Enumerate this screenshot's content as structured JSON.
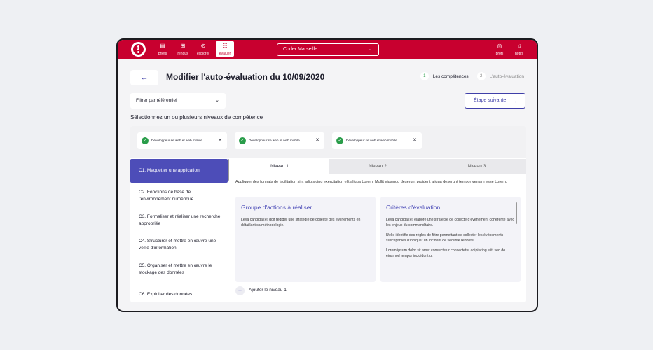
{
  "nav": {
    "items": [
      {
        "label": "briefs",
        "icon": "clipboard-icon"
      },
      {
        "label": "rendus",
        "icon": "gift-icon"
      },
      {
        "label": "explorer",
        "icon": "compass-icon"
      },
      {
        "label": "évaluer",
        "icon": "checklist-icon"
      }
    ],
    "select_value": "Coder Marseille",
    "right_items": [
      {
        "label": "profil",
        "icon": "user-icon"
      },
      {
        "label": "notifs",
        "icon": "bell-icon"
      }
    ]
  },
  "header": {
    "back_icon": "arrow-left-icon",
    "title": "Modifier l'auto-évaluation du 10/09/2020",
    "steps": [
      {
        "num": "1",
        "label": "Les compétences"
      },
      {
        "num": "2",
        "label": "L'auto-évaluation"
      }
    ]
  },
  "filter": {
    "value": "Filtrer par référentiel"
  },
  "next_button": {
    "label": "Étape suivante"
  },
  "subtitle": "Sélectionnez un ou plusieurs niveaux de compétence",
  "chips": [
    {
      "label": "Développeur.se web et web mobile"
    },
    {
      "label": "Développeur.se web et web mobile"
    },
    {
      "label": "Développeur.se web et web mobile"
    }
  ],
  "competences": [
    {
      "label": "C1. Maquetter une application"
    },
    {
      "label": "C2. Fonctions de base de l'environnement numérique"
    },
    {
      "label": "C3. Formaliser et réaliser une recherche appropriée"
    },
    {
      "label": "C4. Structurer et mettre en œuvre une veille d'information"
    },
    {
      "label": "C5. Organiser et mettre en œuvre le stockage des données"
    },
    {
      "label": "C6. Exploiter des données"
    }
  ],
  "tabs": [
    {
      "label": "Niveau 1"
    },
    {
      "label": "Niveau 2"
    },
    {
      "label": "Niveau 3"
    }
  ],
  "level": {
    "description": "Appliquer des formats de facilitation sint adipisicing exercitation elit aliqua Lorem. Mollit eiusmod deserunt proident aliqua deserunt tempor veniam esse Lorem.",
    "actions": {
      "title": "Groupe d'actions à réaliser",
      "text": "Le/la candidat(e) doit rédiger une stratégie de collecte des événements en détaillant sa méthodologie."
    },
    "criteria": {
      "title": "Critères d'évaluation",
      "items": [
        "Le/la candidat(e) élabore une stratégie de collecte d'événement cohérente avec les enjeux du commanditaire.",
        "Il/elle identifie des règles de filtre permettant de collecter les événements susceptibles d'indiquer un incident de sécurité redouté.",
        "Lorem ipsum dolor sit amet consectetur consectetur adipiscing elit, sed do eiusmod tempor incididunt ut"
      ]
    },
    "add_label": "Ajouter le niveau 1"
  }
}
